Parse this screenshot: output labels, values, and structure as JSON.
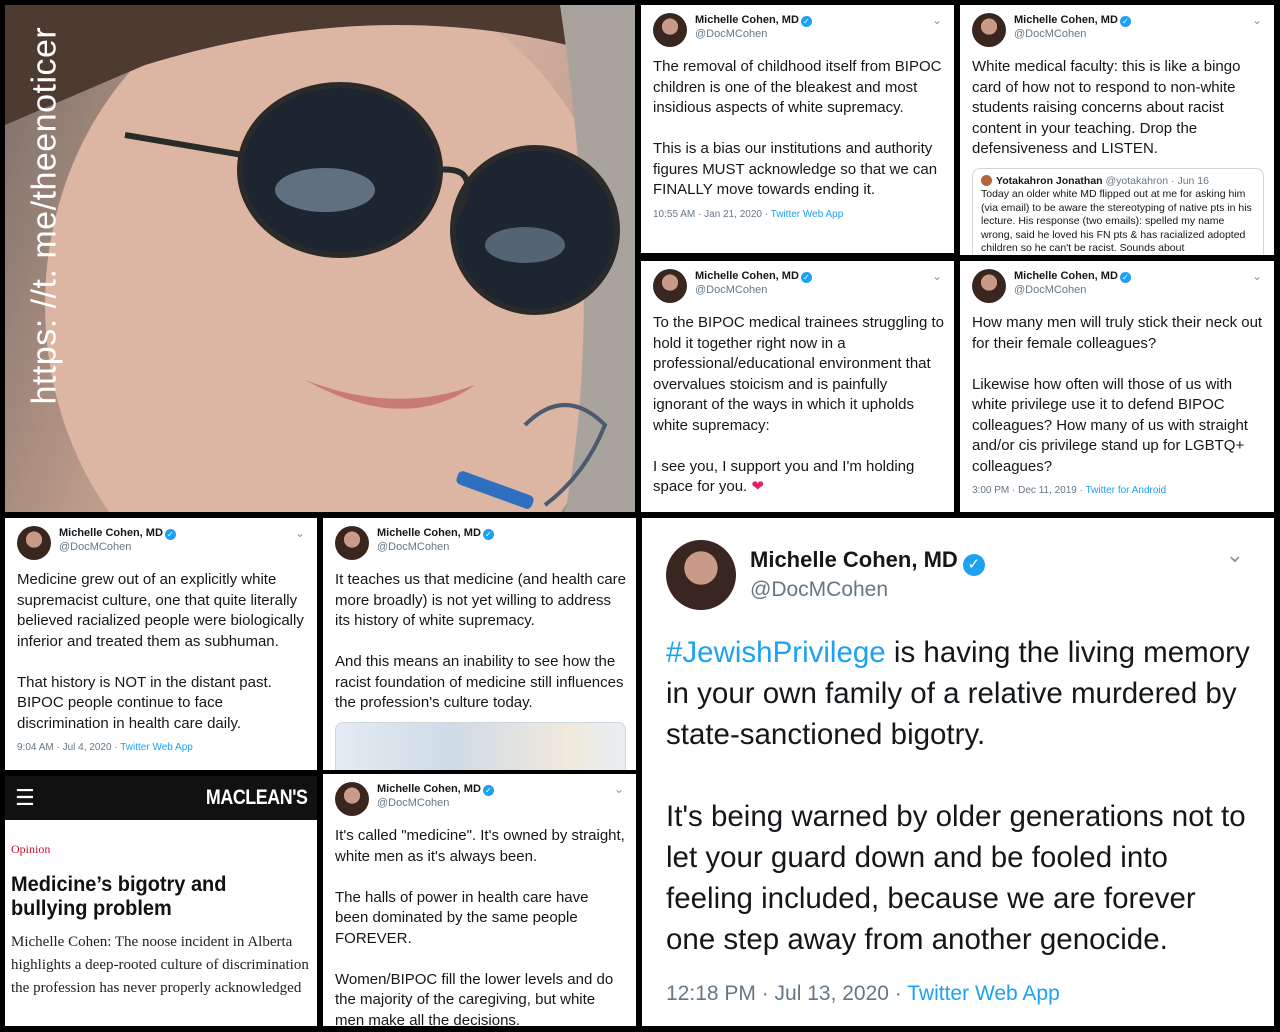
{
  "photo": {
    "watermark": "https: //t. me/theenoticer"
  },
  "author": {
    "name": "Michelle Cohen, MD",
    "handle": "@DocMCohen"
  },
  "tweets": {
    "t1": {
      "body": "The removal of childhood itself from BIPOC children is one of the bleakest and most insidious aspects of white supremacy.\n\nThis is a bias our institutions and authority figures MUST acknowledge so that we can FINALLY move towards ending it.",
      "time": "10:55 AM · Jan 21, 2020 · ",
      "source": "Twitter Web App"
    },
    "t2": {
      "body": "White medical faculty: this is like a bingo card of how not to respond to  non-white students raising concerns about racist content in your teaching. Drop the defensiveness and LISTEN.",
      "quote": {
        "name": "Yotakahron Jonathan",
        "handle": "@yotakahron · Jun 16",
        "text": "Today an older white MD flipped out at me for asking him (via email) to be aware the stereotyping of native pts in his lecture. His response (two emails): spelled my name wrong, said he loved his FN pts & has racialized adopted children so he can't be racist. Sounds about"
      }
    },
    "t3": {
      "body": "To the BIPOC medical trainees struggling to hold it together right now in a professional/educational environment that overvalues stoicism and is painfully ignorant of the ways in which it upholds white supremacy:\n\nI see you, I support you and I'm holding space for you. ",
      "heart": "❤"
    },
    "t4": {
      "body": "How many men will truly stick their neck out for their female colleagues?\n\nLikewise how often will those of us with white privilege use it to defend BIPOC colleagues? How many of us with straight and/or cis privilege stand up for LGBTQ+ colleagues?",
      "time": "3:00 PM · Dec 11, 2019 · ",
      "source": "Twitter for Android"
    },
    "t5": {
      "body": "Medicine grew out of an explicitly white supremacist culture, one that quite literally believed racialized people were biologically inferior and treated them as subhuman.\n\nThat history is NOT in the distant past. BIPOC people continue to face discrimination in health care daily.",
      "time": "9:04 AM · Jul 4, 2020 · ",
      "source": "Twitter Web App"
    },
    "t6": {
      "body": "It teaches us that medicine (and health care more broadly) is not yet willing to address its history of white supremacy.\n\nAnd this means an inability to see how the racist foundation of medicine still influences the profession's culture today."
    },
    "t7": {
      "body": "It's called \"medicine\". It's owned by straight, white men as it's always been.\n\nThe halls of power in health care have been dominated by the same people FOREVER.\n\nWomen/BIPOC fill the lower levels and do the majority of the caregiving, but white men make all the decisions."
    },
    "t8": {
      "hashtag": "#JewishPrivilege",
      "body": " is having the living memory in your own family of a relative murdered by state-sanctioned bigotry.\n\nIt's being warned by older generations not to let your guard down and be fooled into feeling included, because we are forever one step away from another genocide.",
      "time": "12:18 PM · Jul 13, 2020 · ",
      "source": "Twitter Web App"
    }
  },
  "macleans": {
    "logo": "MACLEAN'S",
    "section": "Opinion",
    "headline": "Medicine’s bigotry and bullying problem",
    "dek": "Michelle Cohen: The noose incident in Alberta highlights a deep-rooted culture of discrimination the profession has never properly acknowledged"
  },
  "colors": {
    "link": "#1da1f2",
    "heart": "#e0245e",
    "macleans_red": "#c8102e"
  }
}
